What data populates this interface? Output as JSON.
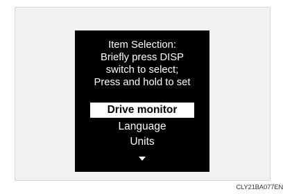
{
  "display": {
    "header_lines": [
      "Item Selection:",
      "Briefly press DISP",
      "switch to select;",
      "Press and hold to set"
    ],
    "menu_items": [
      {
        "label": "Drive monitor",
        "selected": true
      },
      {
        "label": "Language",
        "selected": false
      },
      {
        "label": "Units",
        "selected": false
      }
    ],
    "scroll_indicator": "down-arrow-icon"
  },
  "image_code": "CLY21BA077EN",
  "colors": {
    "screen_bg": "#000000",
    "text": "#ffffff",
    "highlight_bg": "#ffffff",
    "highlight_text": "#000000",
    "frame_bg": "#f1f1f1"
  }
}
